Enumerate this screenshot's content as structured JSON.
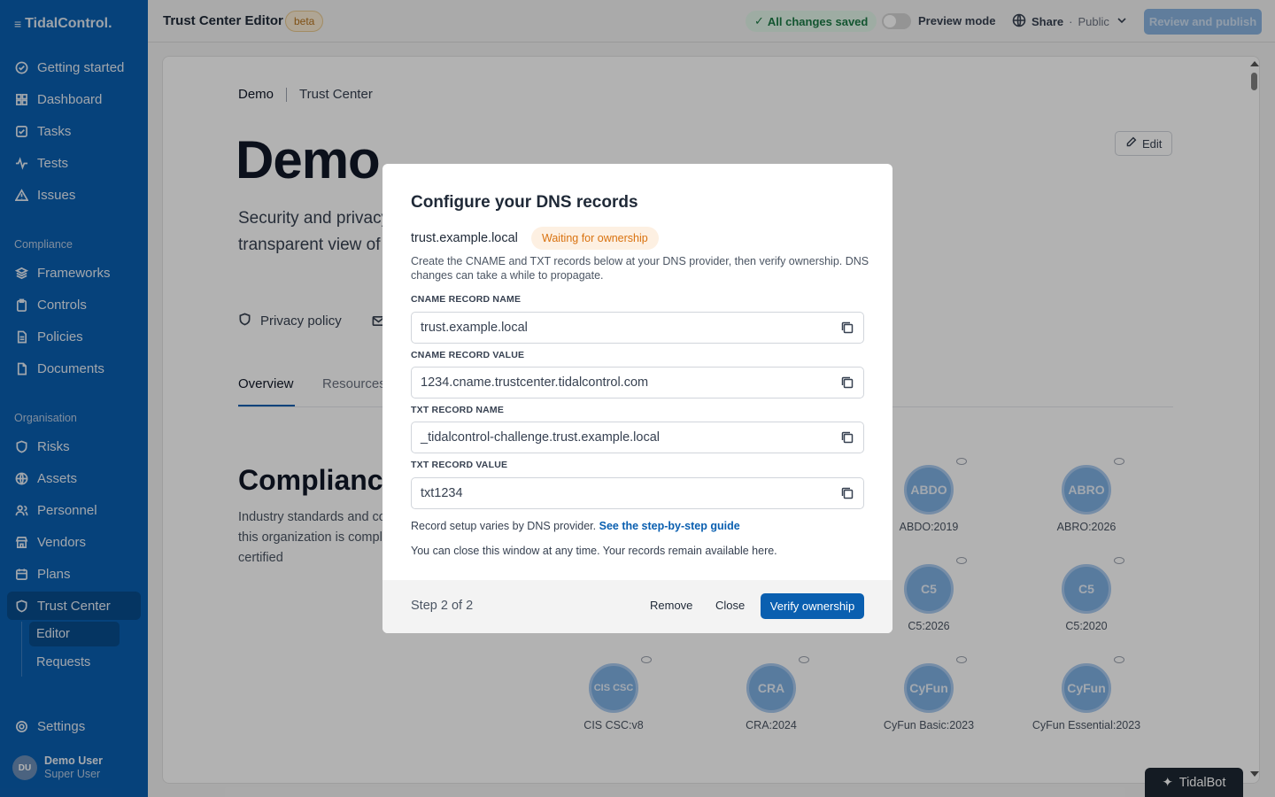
{
  "app": {
    "logo_text": "TidalControl."
  },
  "sidebar": {
    "main_items": [
      {
        "label": "Getting started",
        "icon": "check-circle-icon"
      },
      {
        "label": "Dashboard",
        "icon": "grid-icon"
      },
      {
        "label": "Tasks",
        "icon": "checkbox-icon"
      },
      {
        "label": "Tests",
        "icon": "pulse-icon"
      },
      {
        "label": "Issues",
        "icon": "warning-icon"
      }
    ],
    "compliance_section": "Compliance",
    "compliance_items": [
      {
        "label": "Frameworks",
        "icon": "layers-icon"
      },
      {
        "label": "Controls",
        "icon": "clipboard-icon"
      },
      {
        "label": "Policies",
        "icon": "file-icon"
      },
      {
        "label": "Documents",
        "icon": "document-icon"
      }
    ],
    "organisation_section": "Organisation",
    "organisation_items": [
      {
        "label": "Risks",
        "icon": "shield-alert-icon"
      },
      {
        "label": "Assets",
        "icon": "globe-icon"
      },
      {
        "label": "Personnel",
        "icon": "users-icon"
      },
      {
        "label": "Vendors",
        "icon": "store-icon"
      },
      {
        "label": "Plans",
        "icon": "calendar-icon"
      },
      {
        "label": "Trust Center",
        "icon": "shield-icon"
      }
    ],
    "sub_items": [
      {
        "label": "Editor"
      },
      {
        "label": "Requests"
      }
    ],
    "settings_label": "Settings",
    "user": {
      "initials": "DU",
      "name": "Demo User",
      "role": "Super User"
    }
  },
  "topbar": {
    "title": "Trust Center Editor",
    "beta": "beta",
    "saved": "All changes saved",
    "preview": "Preview mode",
    "share": "Share",
    "share_visibility": "Public",
    "publish": "Review and publish"
  },
  "page": {
    "breadcrumb": [
      "Demo",
      "Trust Center"
    ],
    "heading": "Demo",
    "edit": "Edit",
    "description": "Security and privacy are at the core of what we do. Our Trust Center gives you a transparent view of our security posture so you can verify our standards.",
    "privacy_policy": "Privacy policy",
    "tabs": [
      "Overview",
      "Resources"
    ],
    "compliance_heading": "Compliance",
    "compliance_desc": "Industry standards and compliance frameworks this organization is compliant with or currently certified",
    "badges": [
      {
        "abbr": "ABDO",
        "label": "ABDO:2019"
      },
      {
        "abbr": "ABRO",
        "label": "ABRO:2026"
      },
      {
        "abbr": "C5",
        "label": "C5:2026"
      },
      {
        "abbr": "C5",
        "label": "C5:2020"
      },
      {
        "abbr": "CIS CSC",
        "label": "CIS CSC:v8"
      },
      {
        "abbr": "CRA",
        "label": "CRA:2024"
      },
      {
        "abbr": "CyFun",
        "label": "CyFun Basic:2023"
      },
      {
        "abbr": "CyFun",
        "label": "CyFun Essential:2023"
      }
    ]
  },
  "tidalbot": "TidalBot",
  "modal": {
    "title": "Configure your DNS records",
    "domain": "trust.example.local",
    "status": "Waiting for ownership",
    "help": "Create the CNAME and TXT records below at your DNS provider, then verify ownership. DNS changes can take a while to propagate.",
    "fields": [
      {
        "label": "CNAME RECORD NAME",
        "value": "trust.example.local"
      },
      {
        "label": "CNAME RECORD VALUE",
        "value": "1234.cname.trustcenter.tidalcontrol.com"
      },
      {
        "label": "TXT RECORD NAME",
        "value": "_tidalcontrol-challenge.trust.example.local"
      },
      {
        "label": "TXT RECORD VALUE",
        "value": "txt1234"
      }
    ],
    "guide_text": "Record setup varies by DNS provider.",
    "guide_link": "See the step-by-step guide",
    "close_note": "You can close this window at any time. Your records remain available here.",
    "step": "Step 2 of 2",
    "remove": "Remove",
    "close": "Close",
    "verify": "Verify ownership"
  },
  "colors": {
    "brand": "#0a5fb0",
    "warning": "#d9720f",
    "success": "#1c7a45"
  }
}
